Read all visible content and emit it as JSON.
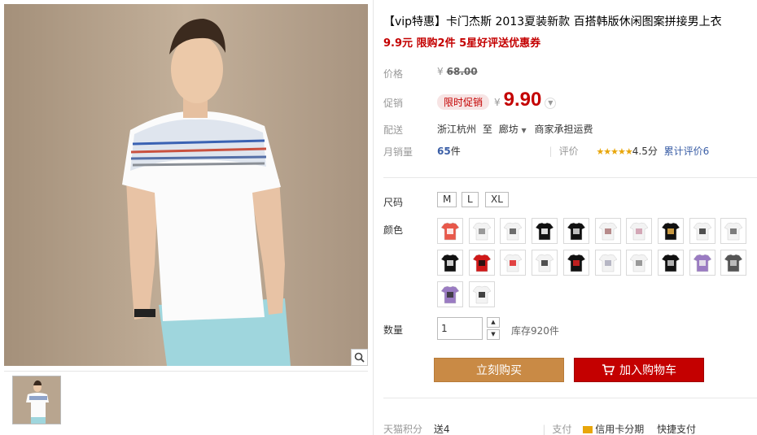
{
  "product": {
    "title": "【vip特惠】卡门杰斯 2013夏装新款 百搭韩版休闲图案拼接男上衣",
    "subtitle": "9.9元 限购2件 5星好评送优惠券"
  },
  "gallery": {
    "main_image": "model-white-tshirt",
    "zoom_icon": "magnifier-icon",
    "thumbnails": [
      "model-white-tshirt-thumb"
    ]
  },
  "price": {
    "label": "价格",
    "currency": "¥",
    "original": "68.00"
  },
  "promo": {
    "label": "促销",
    "badge": "限时促销",
    "currency": "¥",
    "price": "9.90"
  },
  "shipping": {
    "label": "配送",
    "from": "浙江杭州",
    "to_word": "至",
    "destination": "廊坊",
    "fee_note": "商家承担运费"
  },
  "sales": {
    "label": "月销量",
    "count": "65",
    "unit": "件",
    "rating_label": "评价",
    "rating": "4.5分",
    "review_count_label": "累计评价6"
  },
  "size": {
    "label": "尺码",
    "options": [
      "M",
      "L",
      "XL"
    ]
  },
  "color": {
    "label": "颜色",
    "swatches": [
      {
        "shirt": "#e8584a",
        "print": "#fff"
      },
      {
        "shirt": "#f3f3f3",
        "print": "#888"
      },
      {
        "shirt": "#f3f3f3",
        "print": "#555"
      },
      {
        "shirt": "#111111",
        "print": "#fff"
      },
      {
        "shirt": "#111111",
        "print": "#ddd"
      },
      {
        "shirt": "#f3f3f3",
        "print": "#a77"
      },
      {
        "shirt": "#f3f3f3",
        "print": "#c9a"
      },
      {
        "shirt": "#111111",
        "print": "#e8b04a"
      },
      {
        "shirt": "#f3f3f3",
        "print": "#333"
      },
      {
        "shirt": "#f3f3f3",
        "print": "#666"
      },
      {
        "shirt": "#111111",
        "print": "#eee"
      },
      {
        "shirt": "#d01818",
        "print": "#111"
      },
      {
        "shirt": "#f3f3f3",
        "print": "#d22"
      },
      {
        "shirt": "#f3f3f3",
        "print": "#333"
      },
      {
        "shirt": "#111111",
        "print": "#d22"
      },
      {
        "shirt": "#f3f3f3",
        "print": "#aab"
      },
      {
        "shirt": "#f3f3f3",
        "print": "#888"
      },
      {
        "shirt": "#111111",
        "print": "#ccc"
      },
      {
        "shirt": "#9a7bc2",
        "print": "#eee"
      },
      {
        "shirt": "#555555",
        "print": "#ccc"
      },
      {
        "shirt": "#9a7bc2",
        "print": "#333"
      },
      {
        "shirt": "#f3f3f3",
        "print": "#222"
      }
    ]
  },
  "quantity": {
    "label": "数量",
    "value": "1",
    "stock": "库存920件"
  },
  "actions": {
    "buy_now": "立刻购买",
    "add_to_cart": "加入购物车"
  },
  "footer": {
    "points_label": "天猫积分",
    "points_value": "送4",
    "pay_label": "支付",
    "credit": "信用卡分期",
    "quick_pay": "快捷支付"
  },
  "colors": {
    "accent_red": "#c40000",
    "buy_orange": "#c98a45",
    "link_blue": "#3a5ea6",
    "star_yellow": "#e8a60b"
  }
}
